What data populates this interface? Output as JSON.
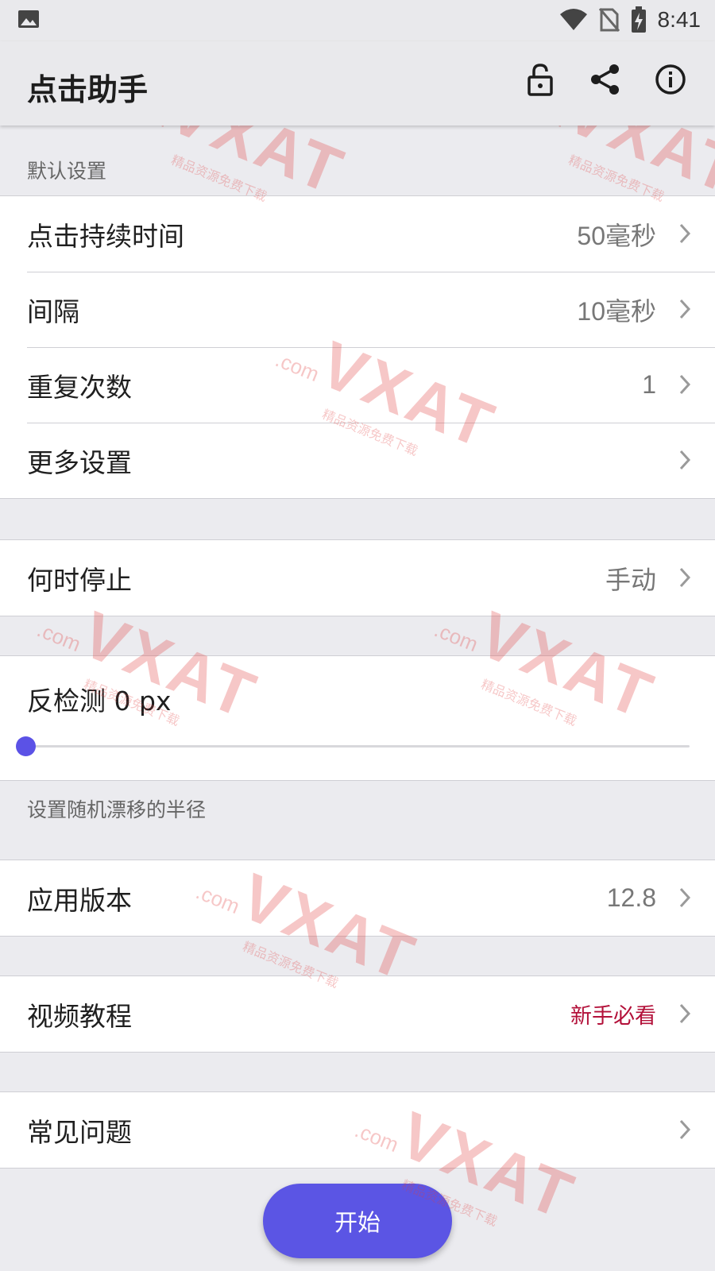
{
  "status_bar": {
    "time": "8:41",
    "icons": [
      "image-icon",
      "wifi-icon",
      "no-sim-icon",
      "battery-charging-icon"
    ]
  },
  "app_bar": {
    "title": "点击助手",
    "actions": [
      "lock-open-icon",
      "share-icon",
      "info-icon"
    ]
  },
  "default_settings": {
    "header": "默认设置",
    "items": [
      {
        "label": "点击持续时间",
        "value": "50毫秒"
      },
      {
        "label": "间隔",
        "value": "10毫秒"
      },
      {
        "label": "重复次数",
        "value": "1"
      },
      {
        "label": "更多设置",
        "value": ""
      }
    ]
  },
  "stop": {
    "label": "何时停止",
    "value": "手动"
  },
  "anti_detect": {
    "label": "反检测 0 px",
    "slider_value": 0,
    "help": "设置随机漂移的半径"
  },
  "version": {
    "label": "应用版本",
    "value": "12.8"
  },
  "tutorial": {
    "label": "视频教程",
    "value": "新手必看",
    "value_color": "#b3113a"
  },
  "faq": {
    "label": "常见问题"
  },
  "fab": {
    "label": "开始",
    "color": "#5b55e4"
  },
  "watermark": {
    "brand": "VXAT",
    "domain": ".com",
    "tagline": "精品资源免费下载"
  }
}
